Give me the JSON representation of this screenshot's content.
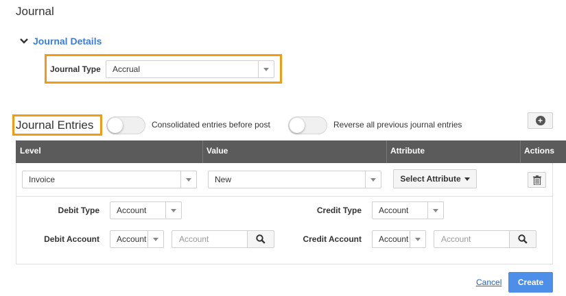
{
  "page": {
    "title": "Journal"
  },
  "details": {
    "section_label": "Journal Details",
    "journal_type_label": "Journal Type",
    "journal_type_value": "Accrual"
  },
  "entries": {
    "title": "Journal Entries",
    "toggle_consolidated_label": "Consolidated entries before post",
    "toggle_consolidated_on": false,
    "toggle_reverse_label": "Reverse all previous journal entries",
    "toggle_reverse_on": false
  },
  "table": {
    "columns": [
      "Level",
      "Value",
      "Attribute",
      "Actions"
    ],
    "row": {
      "level": "Invoice",
      "value": "New",
      "attribute_button": "Select Attribute"
    }
  },
  "detail": {
    "debit_type_label": "Debit Type",
    "debit_type_value": "Account",
    "credit_type_label": "Credit Type",
    "credit_type_value": "Account",
    "debit_account_label": "Debit Account",
    "debit_account_select": "Account",
    "debit_account_placeholder": "Account",
    "credit_account_label": "Credit Account",
    "credit_account_select": "Account",
    "credit_account_placeholder": "Account"
  },
  "footer": {
    "cancel": "Cancel",
    "create": "Create"
  },
  "icons": [
    "chevron-down-icon",
    "plus-icon",
    "trash-icon",
    "search-icon",
    "dropdown-arrow-icon",
    "caret-down-icon"
  ],
  "colors": {
    "highlight": "#f29a12",
    "link": "#3b7dd8",
    "primary": "#4c8ee8",
    "header_bg": "#5b5b5b"
  }
}
